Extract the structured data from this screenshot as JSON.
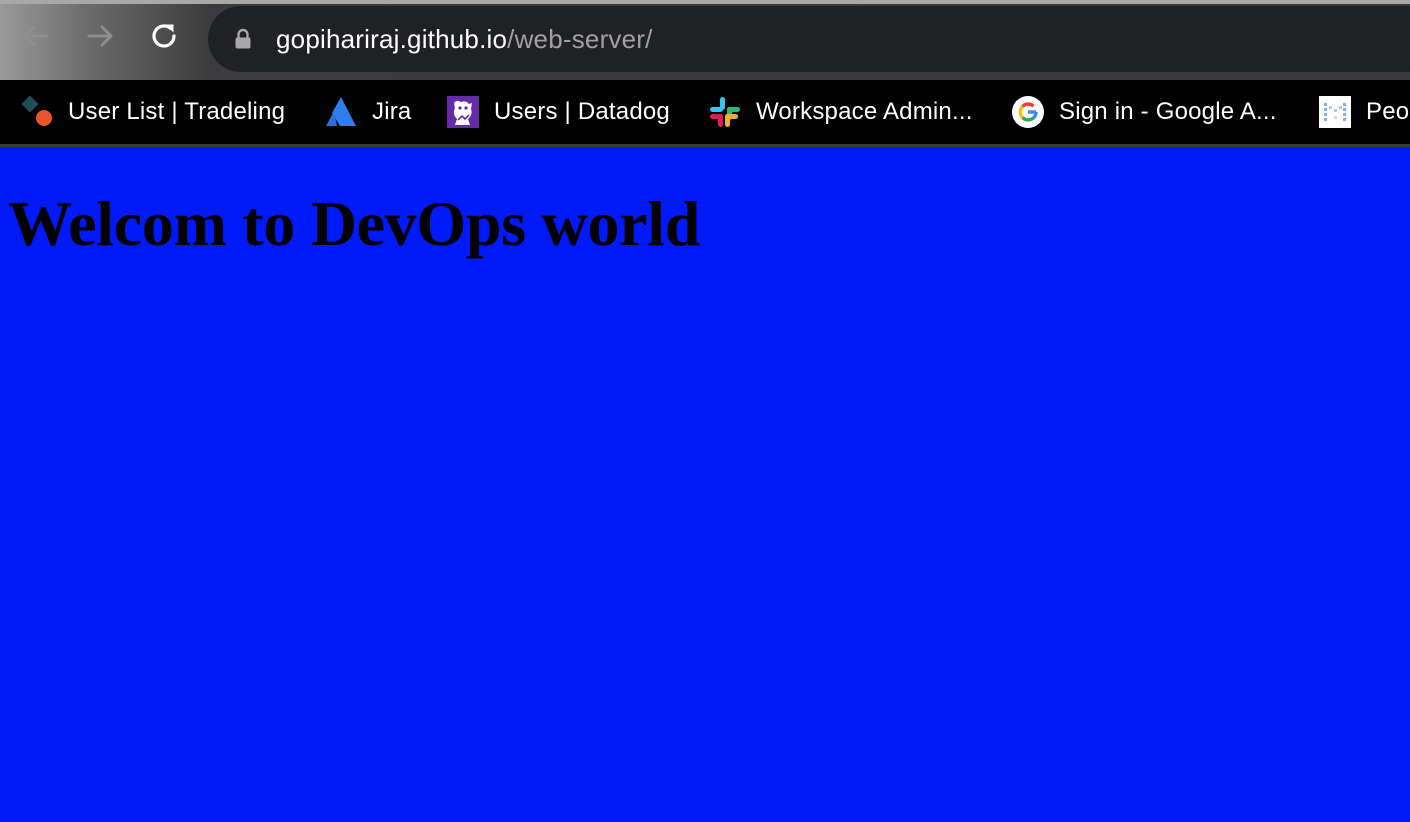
{
  "browser": {
    "url_host": "gopihariraj.github.io",
    "url_path": "/web-server/",
    "icons": {
      "back": "arrow-left-icon",
      "forward": "arrow-right-icon",
      "reload": "reload-icon",
      "lock": "lock-icon"
    }
  },
  "bookmarks": [
    {
      "label": "User List | Tradeling",
      "icon": "tradeling-logo-icon"
    },
    {
      "label": "Jira",
      "icon": "atlassian-logo-icon"
    },
    {
      "label": "Users | Datadog",
      "icon": "datadog-logo-icon"
    },
    {
      "label": "Workspace Admin...",
      "icon": "slack-logo-icon"
    },
    {
      "label": "Sign in - Google A...",
      "icon": "google-logo-icon"
    },
    {
      "label": "Peo",
      "icon": "people-app-icon"
    }
  ],
  "page": {
    "heading": "Welcom to DevOps world",
    "background_color": "#0019f8"
  }
}
